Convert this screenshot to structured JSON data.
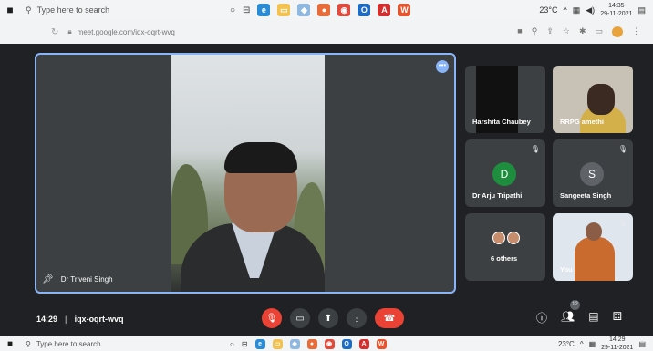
{
  "taskbar": {
    "search_placeholder": "Type here to search",
    "temperature": "23°C",
    "time": "14:35",
    "date": "29-11-2021"
  },
  "taskbar_bottom": {
    "search_placeholder": "Type here to search",
    "temperature": "23°C",
    "time": "14:29",
    "date": "29-11-2021"
  },
  "browser": {
    "url": "meet.google.com/iqx-oqrt-wvq"
  },
  "main_speaker": {
    "name": "Dr Triveni Singh"
  },
  "participants": [
    {
      "name": "Harshita Chaubey"
    },
    {
      "name": "RRPG amethi"
    },
    {
      "name": "Dr Arju Tripathi",
      "initial": "D",
      "color": "#1e8e3e"
    },
    {
      "name": "Sangeeta Singh",
      "initial": "S",
      "color": "#5f6368"
    },
    {
      "name": "6 others"
    },
    {
      "name": "You"
    }
  ],
  "meeting": {
    "time": "14:29",
    "code": "iqx-oqrt-wvq",
    "participant_count": "12"
  },
  "colors": {
    "stage_bg": "#202124",
    "tile_bg": "#3c4043",
    "active_border": "#8ab4f8",
    "danger": "#ea4335"
  }
}
